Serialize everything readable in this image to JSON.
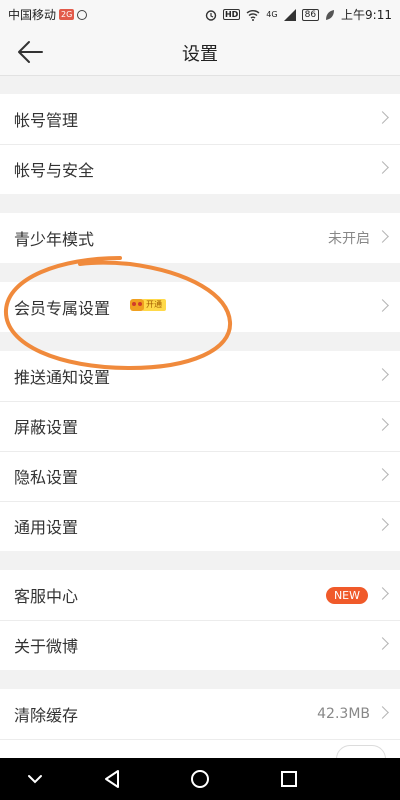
{
  "status_bar": {
    "carrier": "中国移动",
    "carrier_badge": "2G",
    "wifi_label": "4G",
    "hd_label": "HD",
    "battery": "86",
    "time": "上午9:11"
  },
  "header": {
    "title": "设置"
  },
  "groups": {
    "account": [
      {
        "label": "帐号管理"
      },
      {
        "label": "帐号与安全"
      }
    ],
    "youth": {
      "label": "青少年模式",
      "value": "未开启"
    },
    "vip": {
      "label": "会员专属设置",
      "badge": "开通"
    },
    "general": [
      {
        "label": "推送通知设置"
      },
      {
        "label": "屏蔽设置"
      },
      {
        "label": "隐私设置"
      },
      {
        "label": "通用设置"
      }
    ],
    "support": {
      "service": {
        "label": "客服中心",
        "badge": "NEW"
      },
      "about": {
        "label": "关于微博"
      }
    },
    "storage": {
      "label": "清除缓存",
      "value": "42.3MB"
    }
  },
  "icons": {
    "back": "arrow-left-icon",
    "chevron": "chevron-right-icon",
    "nav_back": "triangle-back-icon",
    "nav_home": "circle-home-icon",
    "nav_recent": "square-recent-icon"
  },
  "colors": {
    "accent_orange": "#f05a2a",
    "annotation": "#f08a3c",
    "page_bg": "#f2f2f2"
  }
}
